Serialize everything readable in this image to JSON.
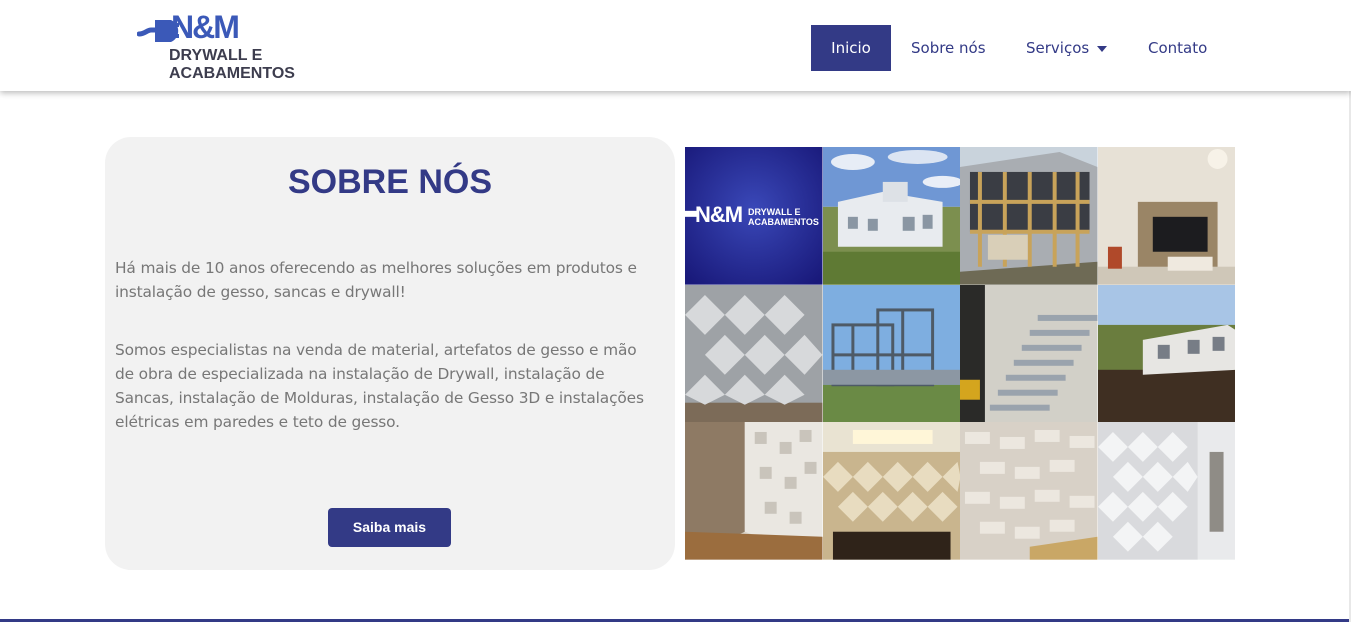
{
  "brand": {
    "mark": "N&M",
    "line1": "DRYWALL E",
    "line2": "ACABAMENTOS"
  },
  "nav": {
    "items": [
      "Inicio",
      "Sobre nós",
      "Serviços",
      "Contato"
    ],
    "active": "Inicio"
  },
  "about": {
    "title": "SOBRE NÓS",
    "paragraph1": "Há mais de 10 anos oferecendo as melhores soluções em produtos e instalação de gesso, sancas e drywall!",
    "paragraph2": "Somos especialistas na venda de material, artefatos de gesso e mão de obra de especializada na instalação de Drywall, instalação de Sancas, instalação de Molduras, instalação de Gesso 3D e instalações elétricas em paredes e teto de gesso.",
    "button": "Saiba mais"
  },
  "gallery": {
    "logo_tile_text": "N&M",
    "logo_tile_line1": "DRYWALL E",
    "logo_tile_line2": "ACABAMENTOS"
  },
  "colors": {
    "primary": "#333a86",
    "logo_blue": "#3b59b8",
    "card_bg": "#f2f2f2",
    "body_text": "#777777"
  }
}
